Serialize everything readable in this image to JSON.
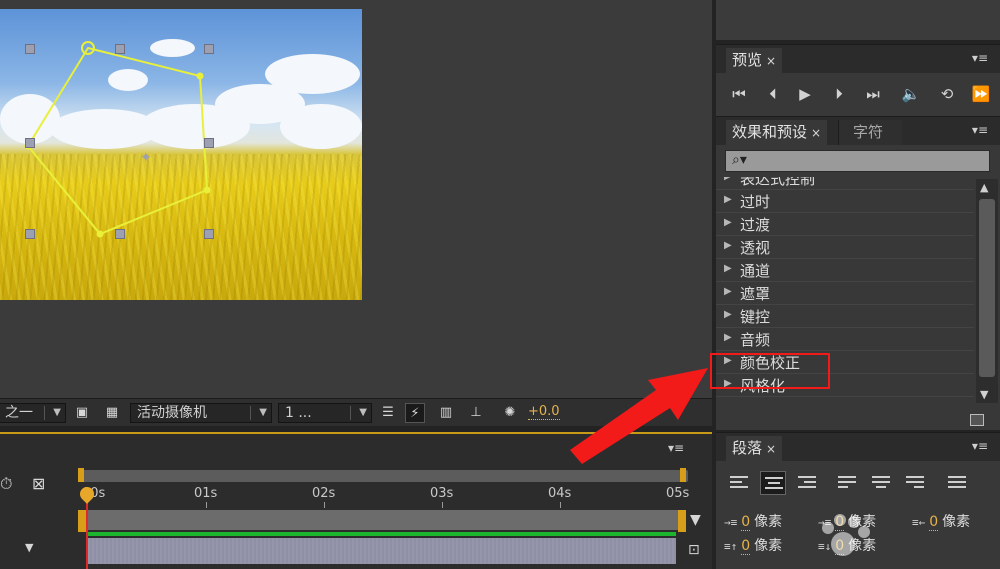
{
  "viewer": {
    "toolbar": {
      "resolution_label": "之一",
      "camera_label": "活动摄像机",
      "views_label": "1 ...",
      "exposure_value": "+0.0"
    }
  },
  "timeline": {
    "ruler": [
      "00s",
      "01s",
      "02s",
      "03s",
      "04s",
      "05s"
    ]
  },
  "preview_panel": {
    "tab_label": "预览",
    "close_glyph": "×"
  },
  "effects_panel": {
    "tab_label": "效果和预设",
    "tab2_label": "字符",
    "close_glyph": "×",
    "search_glyph": "⌕▾",
    "items": [
      "表达式控制",
      "过时",
      "过渡",
      "透视",
      "通道",
      "遮罩",
      "键控",
      "音频",
      "颜色校正",
      "风格化"
    ],
    "highlighted_item": "颜色校正"
  },
  "paragraph_panel": {
    "tab_label": "段落",
    "close_glyph": "×",
    "indent_left_value": "0",
    "indent_left_unit": "像素",
    "indent_first_value": "0",
    "indent_first_unit": "像素",
    "indent_right_value": "0",
    "indent_right_unit": "像素",
    "space_before_value": "0",
    "space_before_unit": "像素",
    "space_after_value": "0",
    "space_after_unit": "像素"
  },
  "colors": {
    "accent": "#e4b34a",
    "highlight_box": "#f31a1a",
    "mask_path": "#e8f03a",
    "playhead": "#e02a2a",
    "layer_green": "#1cb52d"
  },
  "icons": {
    "play": "▶",
    "menu": "▾≡"
  }
}
